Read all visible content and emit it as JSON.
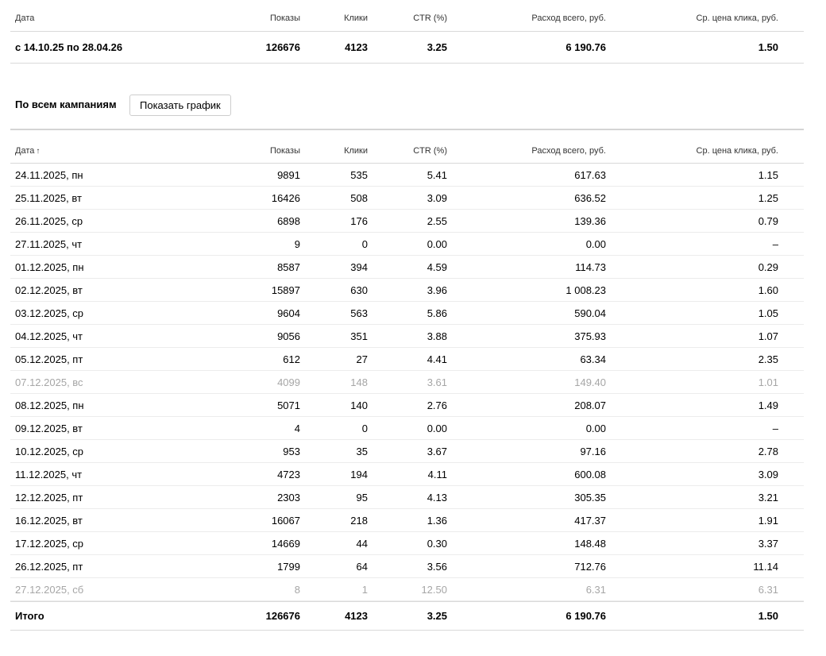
{
  "columns": {
    "date": "Дата",
    "shows": "Показы",
    "clicks": "Клики",
    "ctr": "CTR (%)",
    "cost": "Расход всего, руб.",
    "avg": "Ср. цена клика, руб."
  },
  "summary": {
    "period": "с 14.10.25 по 28.04.26",
    "shows": "126676",
    "clicks": "4123",
    "ctr": "3.25",
    "cost": "6 190.76",
    "avg": "1.50"
  },
  "campaigns": {
    "title": "По всем кампаниям",
    "show_chart_label": "Показать график"
  },
  "daily": {
    "sort_arrow": "↑",
    "rows": [
      {
        "date": "24.11.2025, пн",
        "shows": "9891",
        "clicks": "535",
        "ctr": "5.41",
        "cost": "617.63",
        "avg": "1.15",
        "muted": false
      },
      {
        "date": "25.11.2025, вт",
        "shows": "16426",
        "clicks": "508",
        "ctr": "3.09",
        "cost": "636.52",
        "avg": "1.25",
        "muted": false
      },
      {
        "date": "26.11.2025, ср",
        "shows": "6898",
        "clicks": "176",
        "ctr": "2.55",
        "cost": "139.36",
        "avg": "0.79",
        "muted": false
      },
      {
        "date": "27.11.2025, чт",
        "shows": "9",
        "clicks": "0",
        "ctr": "0.00",
        "cost": "0.00",
        "avg": "–",
        "muted": false
      },
      {
        "date": "01.12.2025, пн",
        "shows": "8587",
        "clicks": "394",
        "ctr": "4.59",
        "cost": "114.73",
        "avg": "0.29",
        "muted": false
      },
      {
        "date": "02.12.2025, вт",
        "shows": "15897",
        "clicks": "630",
        "ctr": "3.96",
        "cost": "1 008.23",
        "avg": "1.60",
        "muted": false
      },
      {
        "date": "03.12.2025, ср",
        "shows": "9604",
        "clicks": "563",
        "ctr": "5.86",
        "cost": "590.04",
        "avg": "1.05",
        "muted": false
      },
      {
        "date": "04.12.2025, чт",
        "shows": "9056",
        "clicks": "351",
        "ctr": "3.88",
        "cost": "375.93",
        "avg": "1.07",
        "muted": false
      },
      {
        "date": "05.12.2025, пт",
        "shows": "612",
        "clicks": "27",
        "ctr": "4.41",
        "cost": "63.34",
        "avg": "2.35",
        "muted": false
      },
      {
        "date": "07.12.2025, вс",
        "shows": "4099",
        "clicks": "148",
        "ctr": "3.61",
        "cost": "149.40",
        "avg": "1.01",
        "muted": true
      },
      {
        "date": "08.12.2025, пн",
        "shows": "5071",
        "clicks": "140",
        "ctr": "2.76",
        "cost": "208.07",
        "avg": "1.49",
        "muted": false
      },
      {
        "date": "09.12.2025, вт",
        "shows": "4",
        "clicks": "0",
        "ctr": "0.00",
        "cost": "0.00",
        "avg": "–",
        "muted": false
      },
      {
        "date": "10.12.2025, ср",
        "shows": "953",
        "clicks": "35",
        "ctr": "3.67",
        "cost": "97.16",
        "avg": "2.78",
        "muted": false
      },
      {
        "date": "11.12.2025, чт",
        "shows": "4723",
        "clicks": "194",
        "ctr": "4.11",
        "cost": "600.08",
        "avg": "3.09",
        "muted": false
      },
      {
        "date": "12.12.2025, пт",
        "shows": "2303",
        "clicks": "95",
        "ctr": "4.13",
        "cost": "305.35",
        "avg": "3.21",
        "muted": false
      },
      {
        "date": "16.12.2025, вт",
        "shows": "16067",
        "clicks": "218",
        "ctr": "1.36",
        "cost": "417.37",
        "avg": "1.91",
        "muted": false
      },
      {
        "date": "17.12.2025, ср",
        "shows": "14669",
        "clicks": "44",
        "ctr": "0.30",
        "cost": "148.48",
        "avg": "3.37",
        "muted": false
      },
      {
        "date": "26.12.2025, пт",
        "shows": "1799",
        "clicks": "64",
        "ctr": "3.56",
        "cost": "712.76",
        "avg": "11.14",
        "muted": false
      },
      {
        "date": "27.12.2025, сб",
        "shows": "8",
        "clicks": "1",
        "ctr": "12.50",
        "cost": "6.31",
        "avg": "6.31",
        "muted": true
      }
    ],
    "total": {
      "label": "Итого",
      "shows": "126676",
      "clicks": "4123",
      "ctr": "3.25",
      "cost": "6 190.76",
      "avg": "1.50"
    }
  }
}
